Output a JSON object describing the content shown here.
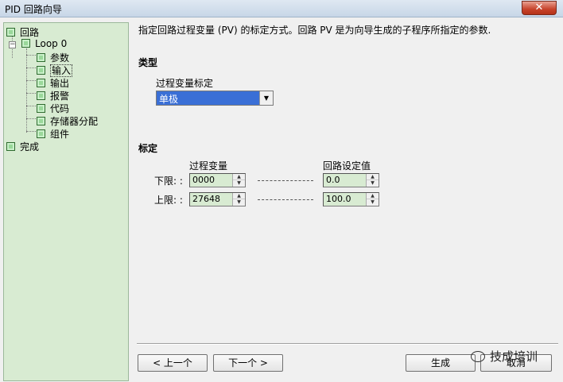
{
  "window": {
    "title": "PID 回路向导",
    "close_glyph": "✕"
  },
  "tree": {
    "root": "回路",
    "loop": "Loop 0",
    "items": [
      "参数",
      "输入",
      "输出",
      "报警",
      "代码",
      "存储器分配",
      "组件"
    ],
    "done": "完成",
    "expander_glyph": "−",
    "selected_index": 1
  },
  "content": {
    "description": "指定回路过程变量 (PV) 的标定方式。回路 PV 是为向导生成的子程序所指定的参数.",
    "type_section": "类型",
    "pv_scaling_label": "过程变量标定",
    "pv_scaling_value": "单极",
    "scale_section": "标定",
    "col_pv": "过程变量",
    "col_sp": "回路设定值",
    "low_label": "下限: :",
    "high_label": "上限: :",
    "low_pv": "0000",
    "high_pv": "27648",
    "low_sp": "0.0",
    "high_sp": "100.0"
  },
  "buttons": {
    "prev": "< 上一个",
    "next": "下一个 >",
    "finish": "生成",
    "cancel": "取消"
  },
  "watermark": "技成培训",
  "icons": {
    "dropdown": "dropdown-arrow-icon",
    "spin": "spin-arrows-icon",
    "wechat": "wechat-icon"
  },
  "colors": {
    "tree_bg": "#d8ebd2",
    "select_bg": "#3a6fd6",
    "spin_bg": "#d8ebd2"
  }
}
